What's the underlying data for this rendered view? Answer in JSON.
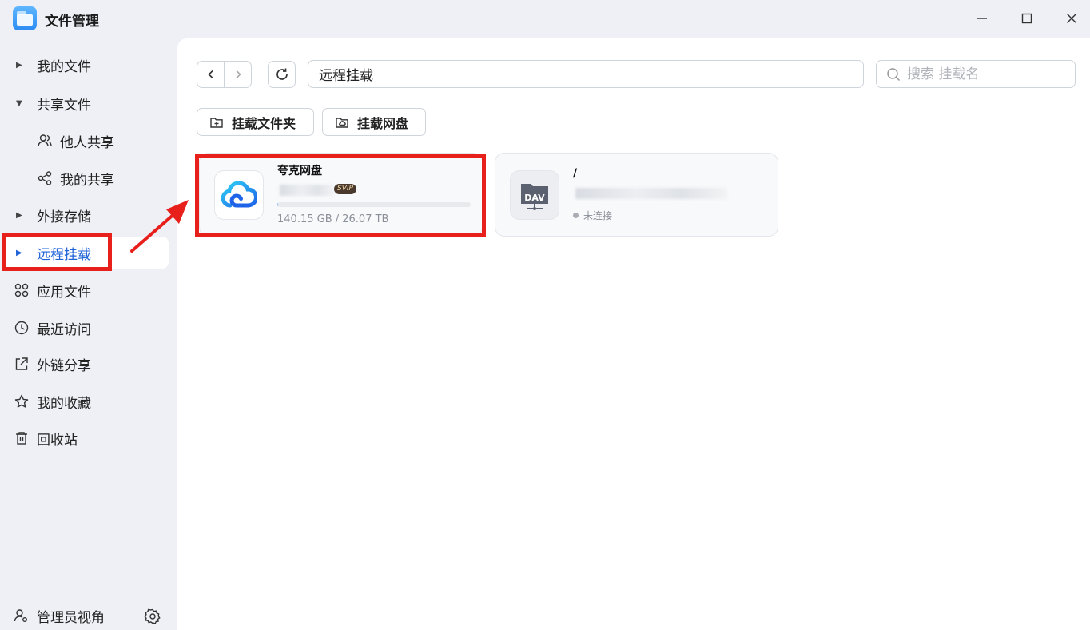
{
  "window": {
    "title": "文件管理",
    "controls": {
      "minimize": "minimize",
      "maximize": "maximize",
      "close": "close"
    }
  },
  "sidebar": {
    "items": [
      {
        "label": "我的文件",
        "type": "caret-collapsed"
      },
      {
        "label": "共享文件",
        "type": "caret-expanded"
      },
      {
        "label": "他人共享",
        "type": "sub",
        "icon": "users-icon"
      },
      {
        "label": "我的共享",
        "type": "sub",
        "icon": "share-icon"
      },
      {
        "label": "外接存储",
        "type": "caret-collapsed"
      },
      {
        "label": "远程挂载",
        "type": "caret-collapsed",
        "active": true
      },
      {
        "label": "应用文件",
        "icon": "apps-grid-icon"
      },
      {
        "label": "最近访问",
        "icon": "clock-icon"
      },
      {
        "label": "外链分享",
        "icon": "external-share-icon"
      },
      {
        "label": "我的收藏",
        "icon": "star-icon"
      },
      {
        "label": "回收站",
        "icon": "trash-icon"
      }
    ],
    "bottom": {
      "label": "管理员视角",
      "icon": "admin-user-icon",
      "settings_icon": "gear-icon"
    }
  },
  "toolbar": {
    "path_value": "远程挂载",
    "search_placeholder": "搜索 挂载名",
    "mount_folder_label": "挂载文件夹",
    "mount_disk_label": "挂载网盘"
  },
  "mounts": [
    {
      "name": "夸克网盘",
      "badge": "SVIP",
      "usage": "140.15 GB / 26.07 TB",
      "usage_fraction": 0.005,
      "icon": "cloud-icon"
    },
    {
      "name": "/",
      "status": "未连接",
      "icon_text": "DAV",
      "icon": "webdav-server-icon"
    }
  ],
  "colors": {
    "accent": "#1f63d8",
    "highlight": "#e8201b",
    "sidebar_bg": "#eef0f5",
    "badge_bg": "#4a3a2e"
  }
}
